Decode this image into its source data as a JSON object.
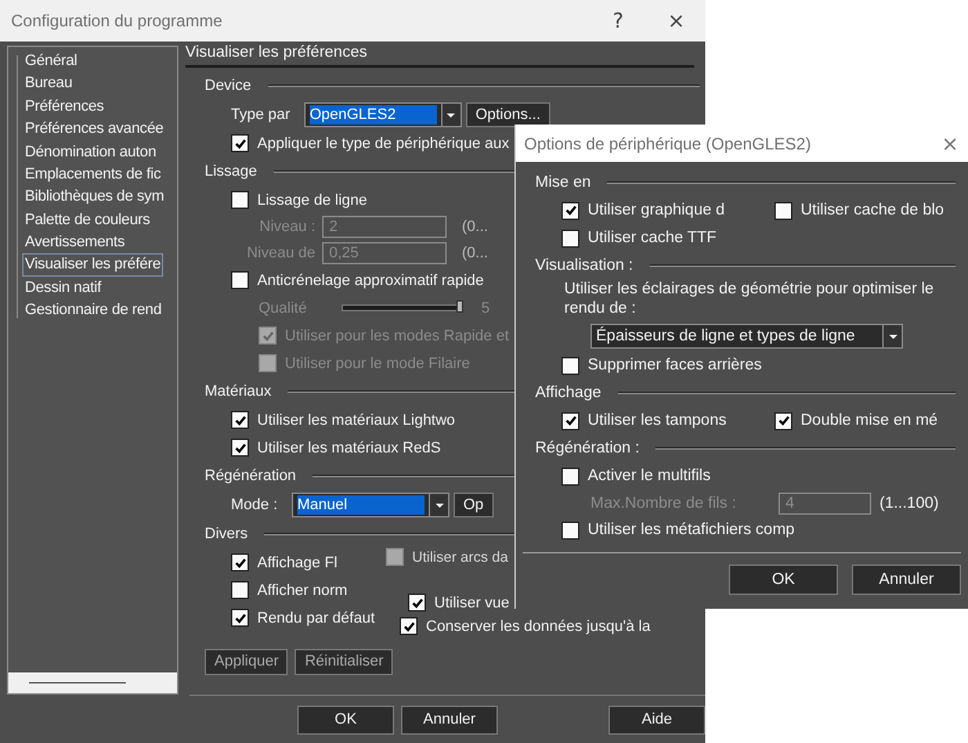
{
  "main_window": {
    "title": "Configuration du programme",
    "help": "?",
    "close": "×",
    "sidebar": [
      {
        "label": "Général",
        "selected": false
      },
      {
        "label": "Bureau",
        "selected": false
      },
      {
        "label": "Préférences",
        "selected": false
      },
      {
        "label": "Préférences avancée",
        "selected": false
      },
      {
        "label": "Dénomination auton",
        "selected": false
      },
      {
        "label": "Emplacements de fic",
        "selected": false
      },
      {
        "label": "Bibliothèques de sym",
        "selected": false
      },
      {
        "label": "Palette de couleurs",
        "selected": false
      },
      {
        "label": "Avertissements",
        "selected": false
      },
      {
        "label": "Visualiser les préfére",
        "selected": true
      },
      {
        "label": "Dessin natif",
        "selected": false
      },
      {
        "label": "Gestionnaire de rend",
        "selected": false
      }
    ],
    "panel_title": "Visualiser les préférences",
    "rows": [
      {
        "kind": "group",
        "label": "Device"
      },
      {
        "kind": "combo",
        "label": "Type par",
        "value": "OpenGLES2",
        "highlighted": true,
        "button": "Options..."
      },
      {
        "kind": "checkbox",
        "label": "Appliquer le type de périphérique aux",
        "checked": true,
        "disabled": false
      },
      {
        "kind": "group",
        "label": "Lissage"
      },
      {
        "kind": "checkbox",
        "label": "Lissage de ligne",
        "checked": false,
        "disabled": false,
        "children": [
          {
            "kind": "field",
            "label": "Niveau :",
            "value": "2",
            "range": "(0...",
            "disabled": true
          },
          {
            "kind": "field",
            "label": "Niveau de",
            "value": "0,25",
            "range": "(0...",
            "disabled": true
          }
        ]
      },
      {
        "kind": "checkbox",
        "label": "Anticrénelage approximatif rapide",
        "checked": false,
        "disabled": false,
        "children": [
          {
            "kind": "slider",
            "label": "Qualité",
            "level": 1,
            "reading": "5",
            "disabled": true
          },
          {
            "kind": "checkbox",
            "label": "Utiliser pour les modes Rapide et",
            "checked": true,
            "disabled": true
          },
          {
            "kind": "checkbox",
            "label": "Utiliser pour le mode Filaire",
            "checked": false,
            "disabled": true
          }
        ]
      },
      {
        "kind": "group",
        "label": "Matériaux"
      },
      {
        "kind": "checkbox",
        "label": "Utiliser les matériaux Lightwo",
        "checked": true,
        "disabled": false
      },
      {
        "kind": "checkbox",
        "label": "Utiliser les matériaux RedS",
        "checked": true,
        "disabled": false
      },
      {
        "kind": "group",
        "label": "Régénération"
      },
      {
        "kind": "combo",
        "label": "Mode :",
        "value": "Manuel",
        "highlighted": true,
        "button": "Op"
      },
      {
        "kind": "group",
        "label": "Divers"
      },
      {
        "kind": "checkbox",
        "label": "Affichage Fl",
        "checked": true,
        "disabled": false
      },
      {
        "kind": "checkbox",
        "label": "Afficher norm",
        "checked": false,
        "disabled": false
      },
      {
        "kind": "checkbox",
        "label": "Rendu par défaut",
        "checked": true,
        "disabled": false
      }
    ],
    "overlaps": [
      {
        "label": "Utiliser arcs da",
        "checked": false,
        "disabled": true
      },
      {
        "label": "Utiliser vue",
        "checked": true,
        "disabled": false
      },
      {
        "label": "Conserver les données jusqu'à la",
        "checked": true,
        "disabled": false
      }
    ],
    "actions": [
      "Appliquer",
      "Réinitialiser"
    ],
    "buttons": [
      "OK",
      "Annuler",
      "Aide"
    ]
  },
  "device_options": {
    "title": "Options de périphérique (OpenGLES2)",
    "close": "×",
    "rows": [
      {
        "kind": "group",
        "label": "Mise en"
      },
      {
        "kind": "pair",
        "items": [
          {
            "label": "Utiliser graphique d",
            "checked": true,
            "disabled": false
          },
          {
            "label": "Utiliser cache de blo",
            "checked": false,
            "disabled": false
          }
        ]
      },
      {
        "kind": "checkbox",
        "label": "Utiliser cache TTF",
        "checked": false,
        "disabled": false
      },
      {
        "kind": "group",
        "label": "Visualisation :"
      },
      {
        "kind": "text",
        "label": "Utiliser les éclairages de géométrie pour optimiser le rendu de :",
        "children": [
          {
            "kind": "combo",
            "value": "Épaisseurs de ligne et types de ligne",
            "highlighted": false
          }
        ]
      },
      {
        "kind": "checkbox",
        "label": "Supprimer faces arrières",
        "checked": false,
        "disabled": false
      },
      {
        "kind": "group",
        "label": "Affichage"
      },
      {
        "kind": "pair",
        "items": [
          {
            "label": "Utiliser les tampons",
            "checked": true,
            "disabled": false
          },
          {
            "label": "Double mise en mé",
            "checked": true,
            "disabled": false
          }
        ]
      },
      {
        "kind": "group",
        "label": "Régénération :"
      },
      {
        "kind": "checkbox",
        "label": "Activer le multifils",
        "checked": false,
        "disabled": false,
        "children": [
          {
            "kind": "field",
            "label": "Max.Nombre de fils :",
            "value": "4",
            "range": "(1...100)",
            "disabled": true
          }
        ]
      },
      {
        "kind": "checkbox",
        "label": "Utiliser les métafichiers comp",
        "checked": false,
        "disabled": false
      }
    ],
    "buttons": [
      "OK",
      "Annuler"
    ]
  }
}
